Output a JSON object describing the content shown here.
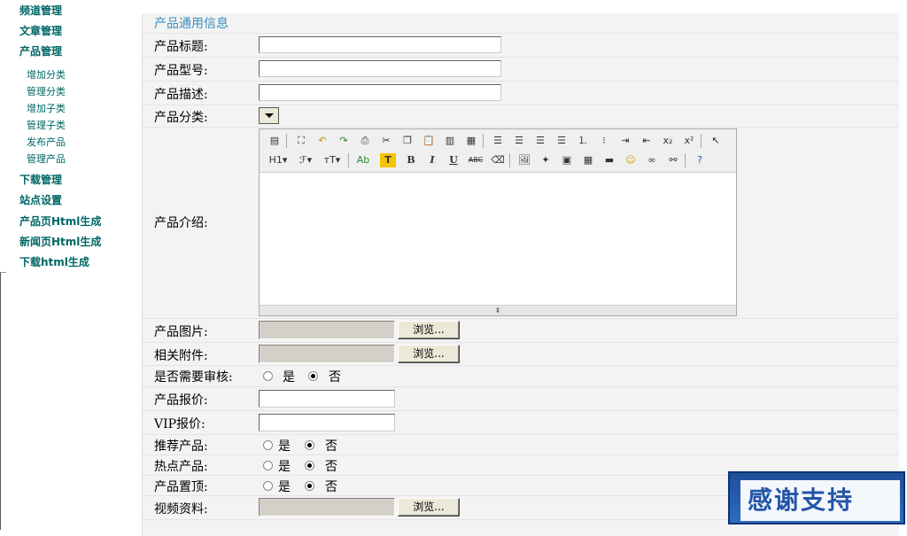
{
  "sidebar": {
    "items": [
      {
        "label": "频道管理"
      },
      {
        "label": "文章管理"
      },
      {
        "label": "产品管理"
      },
      {
        "label": "下载管理"
      },
      {
        "label": "站点设置"
      },
      {
        "label": "产品页Html生成"
      },
      {
        "label": "新闻页Html生成"
      },
      {
        "label": "下载html生成"
      }
    ],
    "sub_items": [
      {
        "label": "增加分类"
      },
      {
        "label": "管理分类"
      },
      {
        "label": "增加子类"
      },
      {
        "label": "管理子类"
      },
      {
        "label": "发布产品"
      },
      {
        "label": "管理产品"
      }
    ]
  },
  "form": {
    "section_title": "产品通用信息",
    "fields": {
      "title": {
        "label": "产品标题:",
        "value": ""
      },
      "model": {
        "label": "产品型号:",
        "value": ""
      },
      "description": {
        "label": "产品描述:",
        "value": ""
      },
      "category": {
        "label": "产品分类:",
        "value": ""
      },
      "intro": {
        "label": "产品介绍:"
      },
      "image": {
        "label": "产品图片:",
        "button": "浏览..."
      },
      "attachment": {
        "label": "相关附件:",
        "button": "浏览..."
      },
      "audit": {
        "label": "是否需要审核:",
        "yes": "是",
        "no": "否",
        "selected": "否"
      },
      "price": {
        "label": "产品报价:",
        "value": ""
      },
      "vip_price": {
        "label": "VIP报价:",
        "value": ""
      },
      "recommend": {
        "label": "推荐产品:",
        "yes": "是",
        "no": "否",
        "selected": "否"
      },
      "hot": {
        "label": "热点产品:",
        "yes": "是",
        "no": "否",
        "selected": "否"
      },
      "top": {
        "label": "产品置顶:",
        "yes": "是",
        "no": "否",
        "selected": "否"
      },
      "video": {
        "label": "视频资料:",
        "button": "浏览..."
      }
    }
  },
  "editor": {
    "toolbar_row1_icons": [
      "source-icon",
      "maximize-icon",
      "undo-icon",
      "redo-icon",
      "print-icon",
      "cut-icon",
      "copy-icon",
      "paste-icon",
      "paste-text-icon",
      "paste-word-icon",
      "align-left-icon",
      "align-center-icon",
      "align-right-icon",
      "align-justify-icon",
      "ordered-list-icon",
      "unordered-list-icon",
      "indent-icon",
      "outdent-icon",
      "subscript-icon",
      "superscript-icon",
      "select-all-icon"
    ],
    "toolbar_row2_labels": {
      "heading": "H1",
      "font": "ℱ",
      "size": "тT",
      "forecolor": "Ab",
      "hilite": "T",
      "bold": "B",
      "italic": "I",
      "underline": "U",
      "strike": "ABC"
    }
  },
  "badge": {
    "text": "感谢支持"
  },
  "colors": {
    "nav": "#006666",
    "section_title": "#3b8ec2",
    "form_bg": "#f3f3f3",
    "badge": "#2456a8"
  }
}
